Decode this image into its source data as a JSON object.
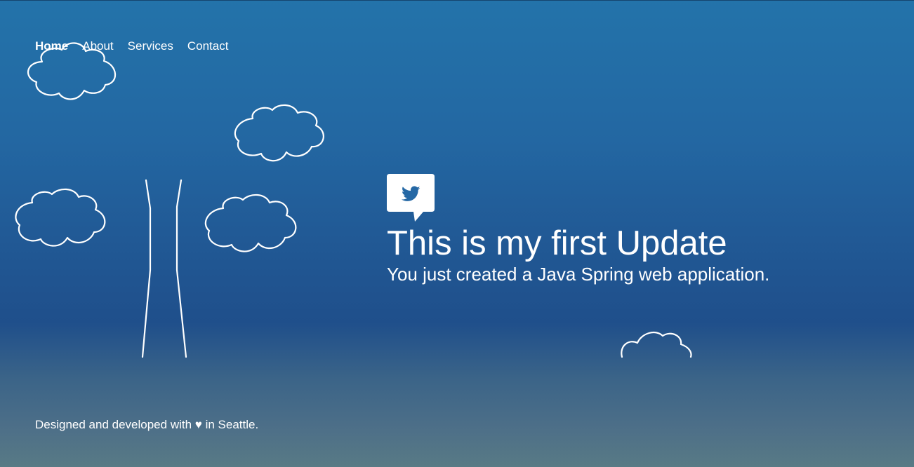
{
  "nav": {
    "items": [
      {
        "label": "Home",
        "active": true
      },
      {
        "label": "About",
        "active": false
      },
      {
        "label": "Services",
        "active": false
      },
      {
        "label": "Contact",
        "active": false
      }
    ]
  },
  "hero": {
    "icon": "twitter-bird-icon",
    "title": "This is my first Update",
    "subtitle": "You just created a Java Spring web application."
  },
  "footer": {
    "text": "Designed and developed with ♥ in Seattle."
  },
  "colors": {
    "background_top": "#2373aa",
    "background_mid": "#1f4f8b",
    "background_bottom": "#587a85",
    "text": "#ffffff",
    "icon_fill": "#2568a5"
  }
}
